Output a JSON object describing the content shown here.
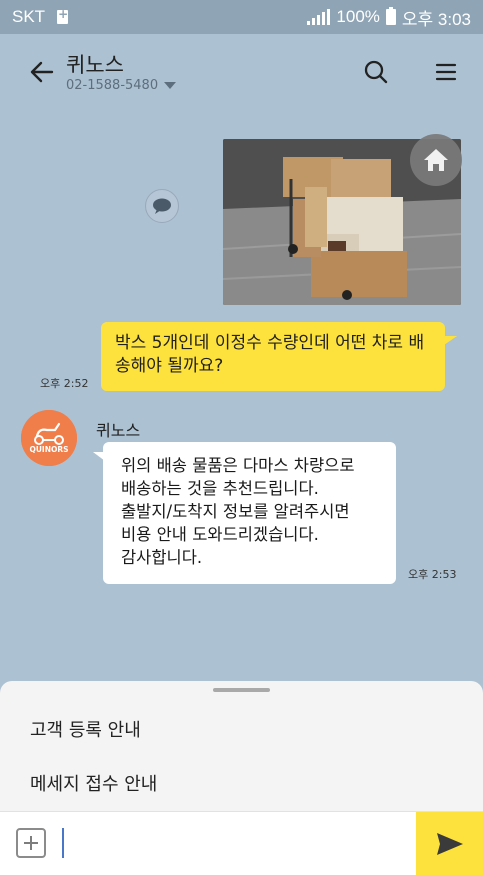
{
  "status_bar": {
    "carrier": "SKT",
    "battery": "100%",
    "time": "오후 3:03"
  },
  "header": {
    "title": "퀴노스",
    "subtitle": "02-1588-5480"
  },
  "messages": [
    {
      "from": "me",
      "text": "박스 5개인데 이정수 수량인데 어떤 차로 배송해야 될까요?",
      "time": "오후 2:52"
    },
    {
      "from": "them",
      "sender": "퀴노스",
      "avatar_text": "QUINORS",
      "lines": [
        "위의 배송 물품은 다마스 차량으로",
        "배송하는 것을 추천드립니다.",
        "출발지/도착지 정보를 알려주시면",
        "비용 안내 도와드리겠습니다.",
        "감사합니다."
      ],
      "time": "오후 2:53"
    }
  ],
  "quick_replies": [
    "고객 등록 안내",
    "메세지 접수 안내"
  ],
  "input": {
    "value": ""
  },
  "icons": {
    "back": "arrow-left-icon",
    "search": "search-icon",
    "menu": "hamburger-icon",
    "home": "home-icon",
    "chat": "speech-bubble-icon",
    "attach": "plus-square-icon",
    "send": "send-icon"
  },
  "colors": {
    "background": "#acc1d2",
    "my_bubble": "#fde23d",
    "their_bubble": "#ffffff",
    "send_button": "#fde23d",
    "avatar": "#f07e4b"
  }
}
